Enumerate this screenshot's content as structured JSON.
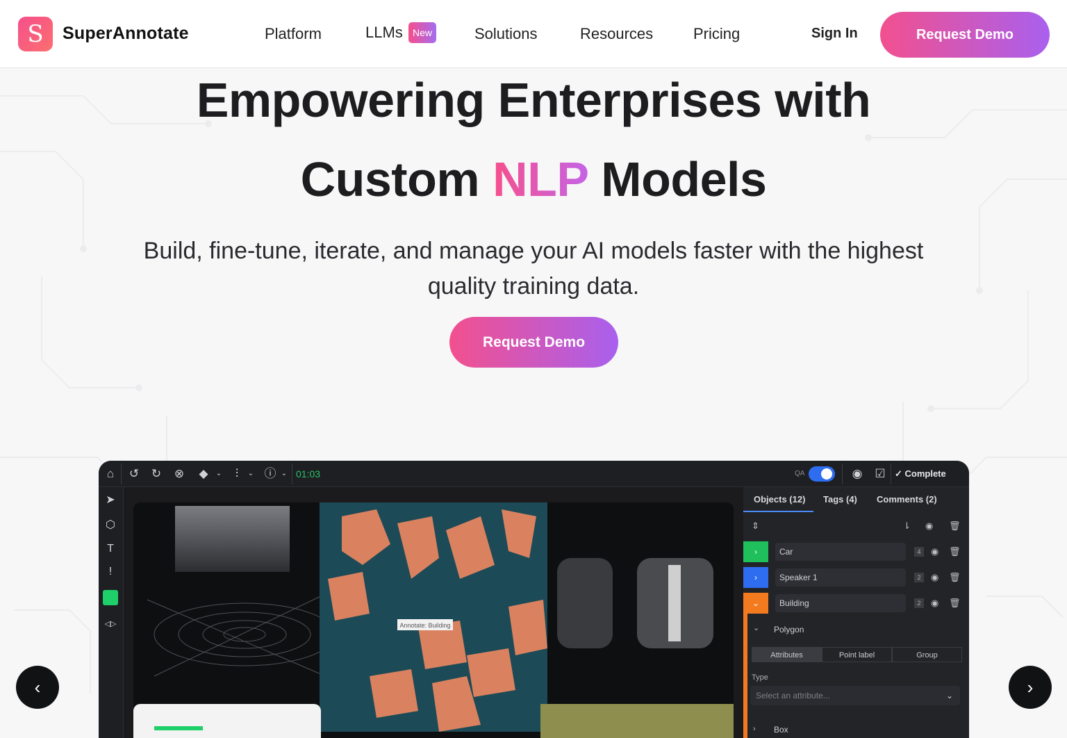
{
  "brand": {
    "name": "SuperAnnotate",
    "logo_letter": "S"
  },
  "nav": {
    "items": [
      "Platform",
      "LLMs",
      "Solutions",
      "Resources",
      "Pricing"
    ],
    "llms_badge": "New",
    "sign_in": "Sign In",
    "request_demo": "Request Demo"
  },
  "hero": {
    "line1": "Empowering Enterprises with",
    "line2_before": "Custom",
    "line2_accent": "NLP",
    "line2_after": "Models",
    "subtitle": "Build, fine-tune, iterate, and manage your AI models faster with the highest quality training data.",
    "cta": "Request Demo"
  },
  "carousel": {
    "prev_icon": "chevron-left-icon",
    "next_icon": "chevron-right-icon"
  },
  "app_preview": {
    "timer": "01:03",
    "qa_label": "QA",
    "complete_label": "Complete",
    "tabs": [
      "Objects (12)",
      "Tags (4)",
      "Comments (2)"
    ],
    "objects": [
      {
        "name": "Car",
        "count": "4",
        "color": "#1fbf5c",
        "chevron": "›"
      },
      {
        "name": "Speaker 1",
        "count": "2",
        "color": "#2f6df0",
        "chevron": "›"
      },
      {
        "name": "Building",
        "count": "2",
        "color": "#f37a1f",
        "chevron": "⌄"
      }
    ],
    "polygon_label": "Polygon",
    "segments": [
      "Attributes",
      "Point label",
      "Group"
    ],
    "type_label": "Type",
    "select_placeholder": "Select an attribute...",
    "box_label": "Box",
    "annotate_tooltip": "Annotate: Building"
  },
  "colors": {
    "accent_start": "#f2508e",
    "accent_end": "#a960ee"
  }
}
